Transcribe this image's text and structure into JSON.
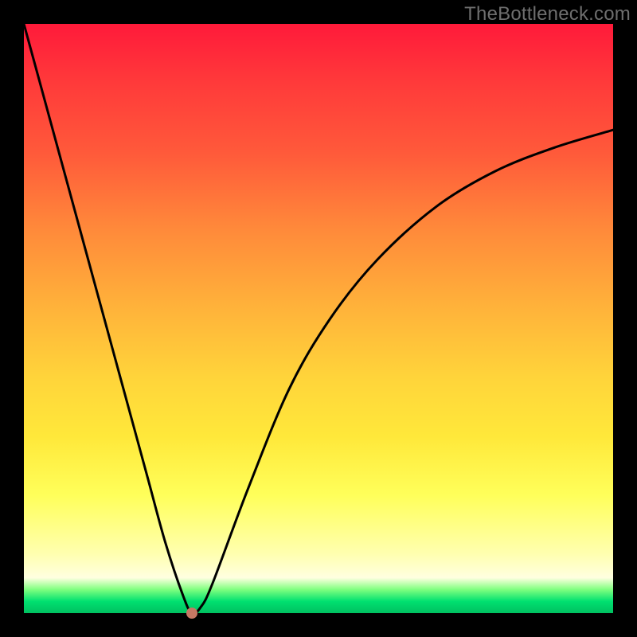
{
  "watermark": "TheBottleneck.com",
  "chart_data": {
    "type": "line",
    "title": "",
    "xlabel": "",
    "ylabel": "",
    "xlim": [
      0,
      1
    ],
    "ylim": [
      0,
      1
    ],
    "axes_visible": false,
    "grid": false,
    "background_gradient": {
      "direction": "vertical",
      "stops": [
        {
          "pos": 0.0,
          "color": "#ff1a3a"
        },
        {
          "pos": 0.5,
          "color": "#ffc83a"
        },
        {
          "pos": 0.8,
          "color": "#ffff5a"
        },
        {
          "pos": 0.95,
          "color": "#ffffe0"
        },
        {
          "pos": 1.0,
          "color": "#00c060"
        }
      ]
    },
    "series": [
      {
        "name": "bottleneck-curve",
        "x": [
          0.0,
          0.03,
          0.06,
          0.09,
          0.12,
          0.15,
          0.18,
          0.21,
          0.24,
          0.27,
          0.285,
          0.3,
          0.32,
          0.38,
          0.45,
          0.52,
          0.6,
          0.7,
          0.8,
          0.9,
          1.0
        ],
        "y": [
          1.0,
          0.89,
          0.78,
          0.67,
          0.56,
          0.45,
          0.34,
          0.23,
          0.12,
          0.03,
          0.0,
          0.01,
          0.05,
          0.21,
          0.38,
          0.5,
          0.6,
          0.69,
          0.75,
          0.79,
          0.82
        ],
        "color": "#000000",
        "linewidth": 2
      }
    ],
    "marker": {
      "name": "minimum-point",
      "x": 0.285,
      "y": 0.0,
      "color": "#c57864",
      "shape": "circle"
    }
  }
}
